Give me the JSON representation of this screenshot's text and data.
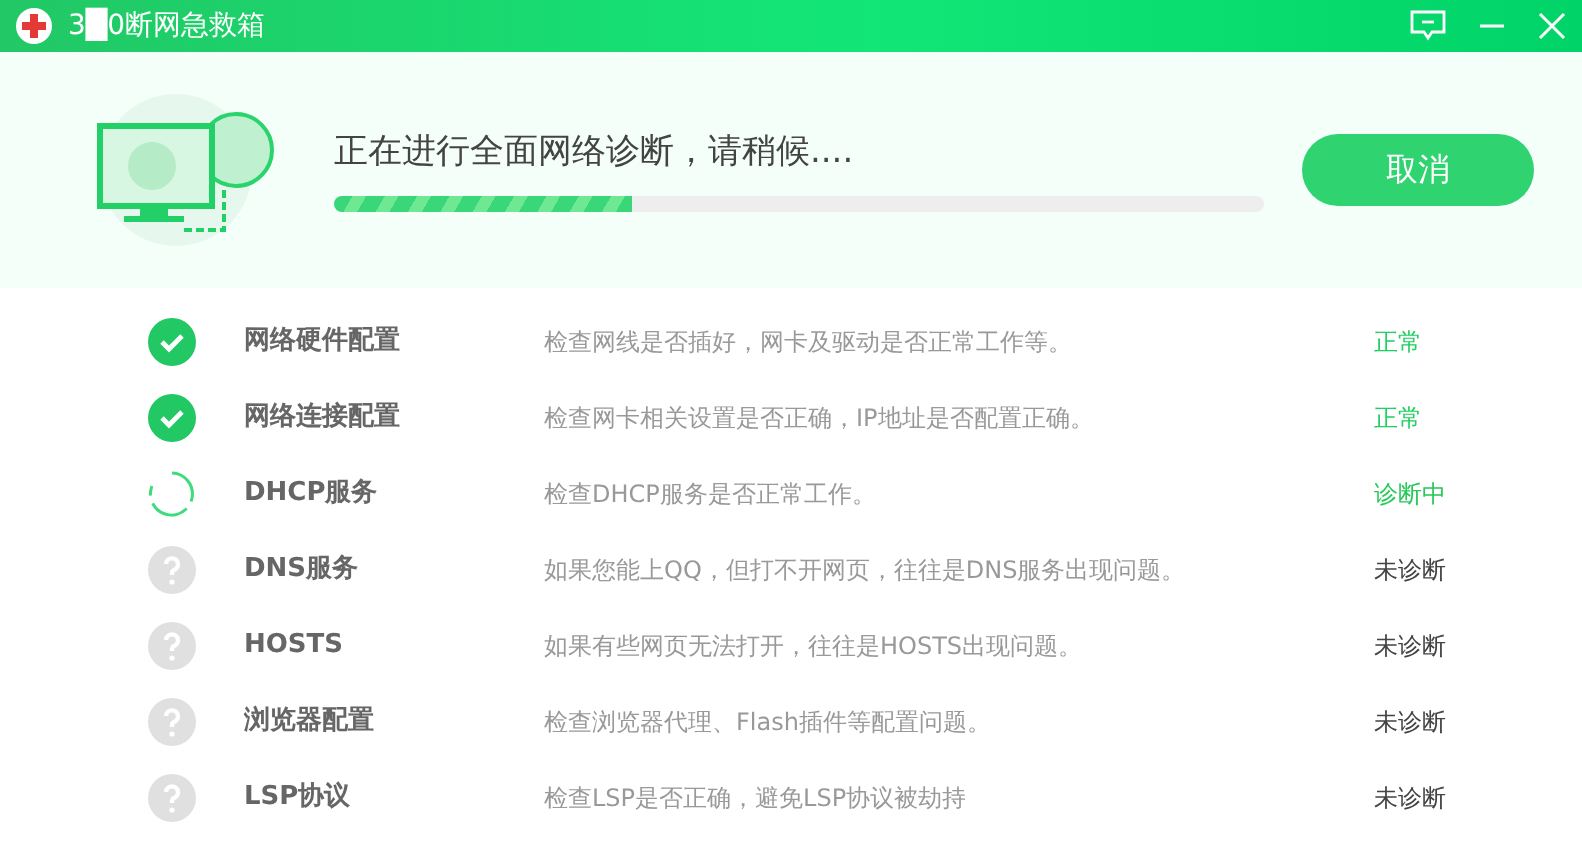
{
  "window": {
    "title": "3█0断网急救箱"
  },
  "progress": {
    "message": "正在进行全面网络诊断，请稍候....",
    "level": 0.32
  },
  "cancel_button": "取消",
  "checks": [
    {
      "kind": "ok",
      "name": "网络硬件配置",
      "description": "检查网线是否插好，网卡及驱动是否正常工作等。",
      "status": "正常"
    },
    {
      "kind": "ok",
      "name": "网络连接配置",
      "description": "检查网卡相关设置是否正确，IP地址是否配置正确。",
      "status": "正常"
    },
    {
      "kind": "running",
      "name": "DHCP服务",
      "description": "检查DHCP服务是否正常工作。",
      "status": "诊断中"
    },
    {
      "kind": "pending",
      "name": "DNS服务",
      "description": "如果您能上QQ，但打不开网页，往往是DNS服务出现问题。",
      "status": "未诊断"
    },
    {
      "kind": "pending",
      "name": "HOSTS",
      "description": "如果有些网页无法打开，往往是HOSTS出现问题。",
      "status": "未诊断"
    },
    {
      "kind": "pending",
      "name": "浏览器配置",
      "description": "检查浏览器代理、Flash插件等配置问题。",
      "status": "未诊断"
    },
    {
      "kind": "pending",
      "name": "LSP协议",
      "description": "检查LSP是否正确，避免LSP协议被劫持",
      "status": "未诊断"
    }
  ]
}
